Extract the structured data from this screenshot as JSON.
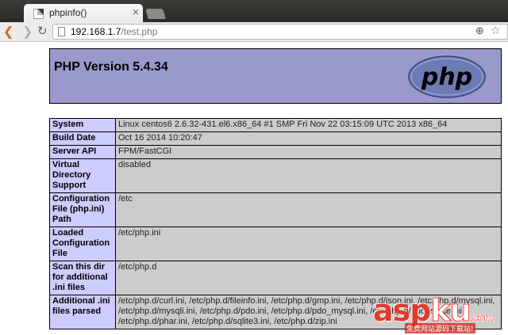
{
  "browser": {
    "tab_title": "phpinfo()",
    "tab_close": "×",
    "url_host": "192.168.1.7",
    "url_path": "/test.php",
    "icons": {
      "back": "back-arrow-icon",
      "forward": "forward-arrow-icon",
      "reload": "reload-icon",
      "zoom": "zoom-icon",
      "bookmark": "star-icon"
    }
  },
  "header": {
    "title": "PHP Version 5.4.34",
    "logo_text": "php",
    "background": "#9999cc"
  },
  "rows": [
    {
      "label": "System",
      "value": "Linux centos6 2.6.32-431.el6.x86_64 #1 SMP Fri Nov 22 03:15:09 UTC 2013 x86_64"
    },
    {
      "label": "Build Date",
      "value": "Oct 16 2014 10:20:47"
    },
    {
      "label": "Server API",
      "value": "FPM/FastCGI"
    },
    {
      "label": "Virtual Directory Support",
      "value": "disabled"
    },
    {
      "label": "Configuration File (php.ini) Path",
      "value": "/etc"
    },
    {
      "label": "Loaded Configuration File",
      "value": "/etc/php.ini"
    },
    {
      "label": "Scan this dir for additional .ini files",
      "value": "/etc/php.d"
    },
    {
      "label": "Additional .ini files parsed",
      "value": "/etc/php.d/curl.ini, /etc/php.d/fileinfo.ini, /etc/php.d/gmp.ini, /etc/php.d/json.ini, /etc/php.d/mysql.ini, /etc/php.d/mysqli.ini, /etc/php.d/pdo.ini, /etc/php.d/pdo_mysql.ini, /etc/php.d/pdo_sqlite.ini, /etc/php.d/phar.ini, /etc/php.d/sqlite3.ini, /etc/php.d/zip.ini"
    }
  ],
  "colors": {
    "label_cell": "#ccccff",
    "value_cell": "#cccccc"
  },
  "watermark": {
    "brand_asp": "asp",
    "brand_ku": "ku",
    "brand_tld": ".com",
    "tagline": "免费网站源码下载站!"
  }
}
